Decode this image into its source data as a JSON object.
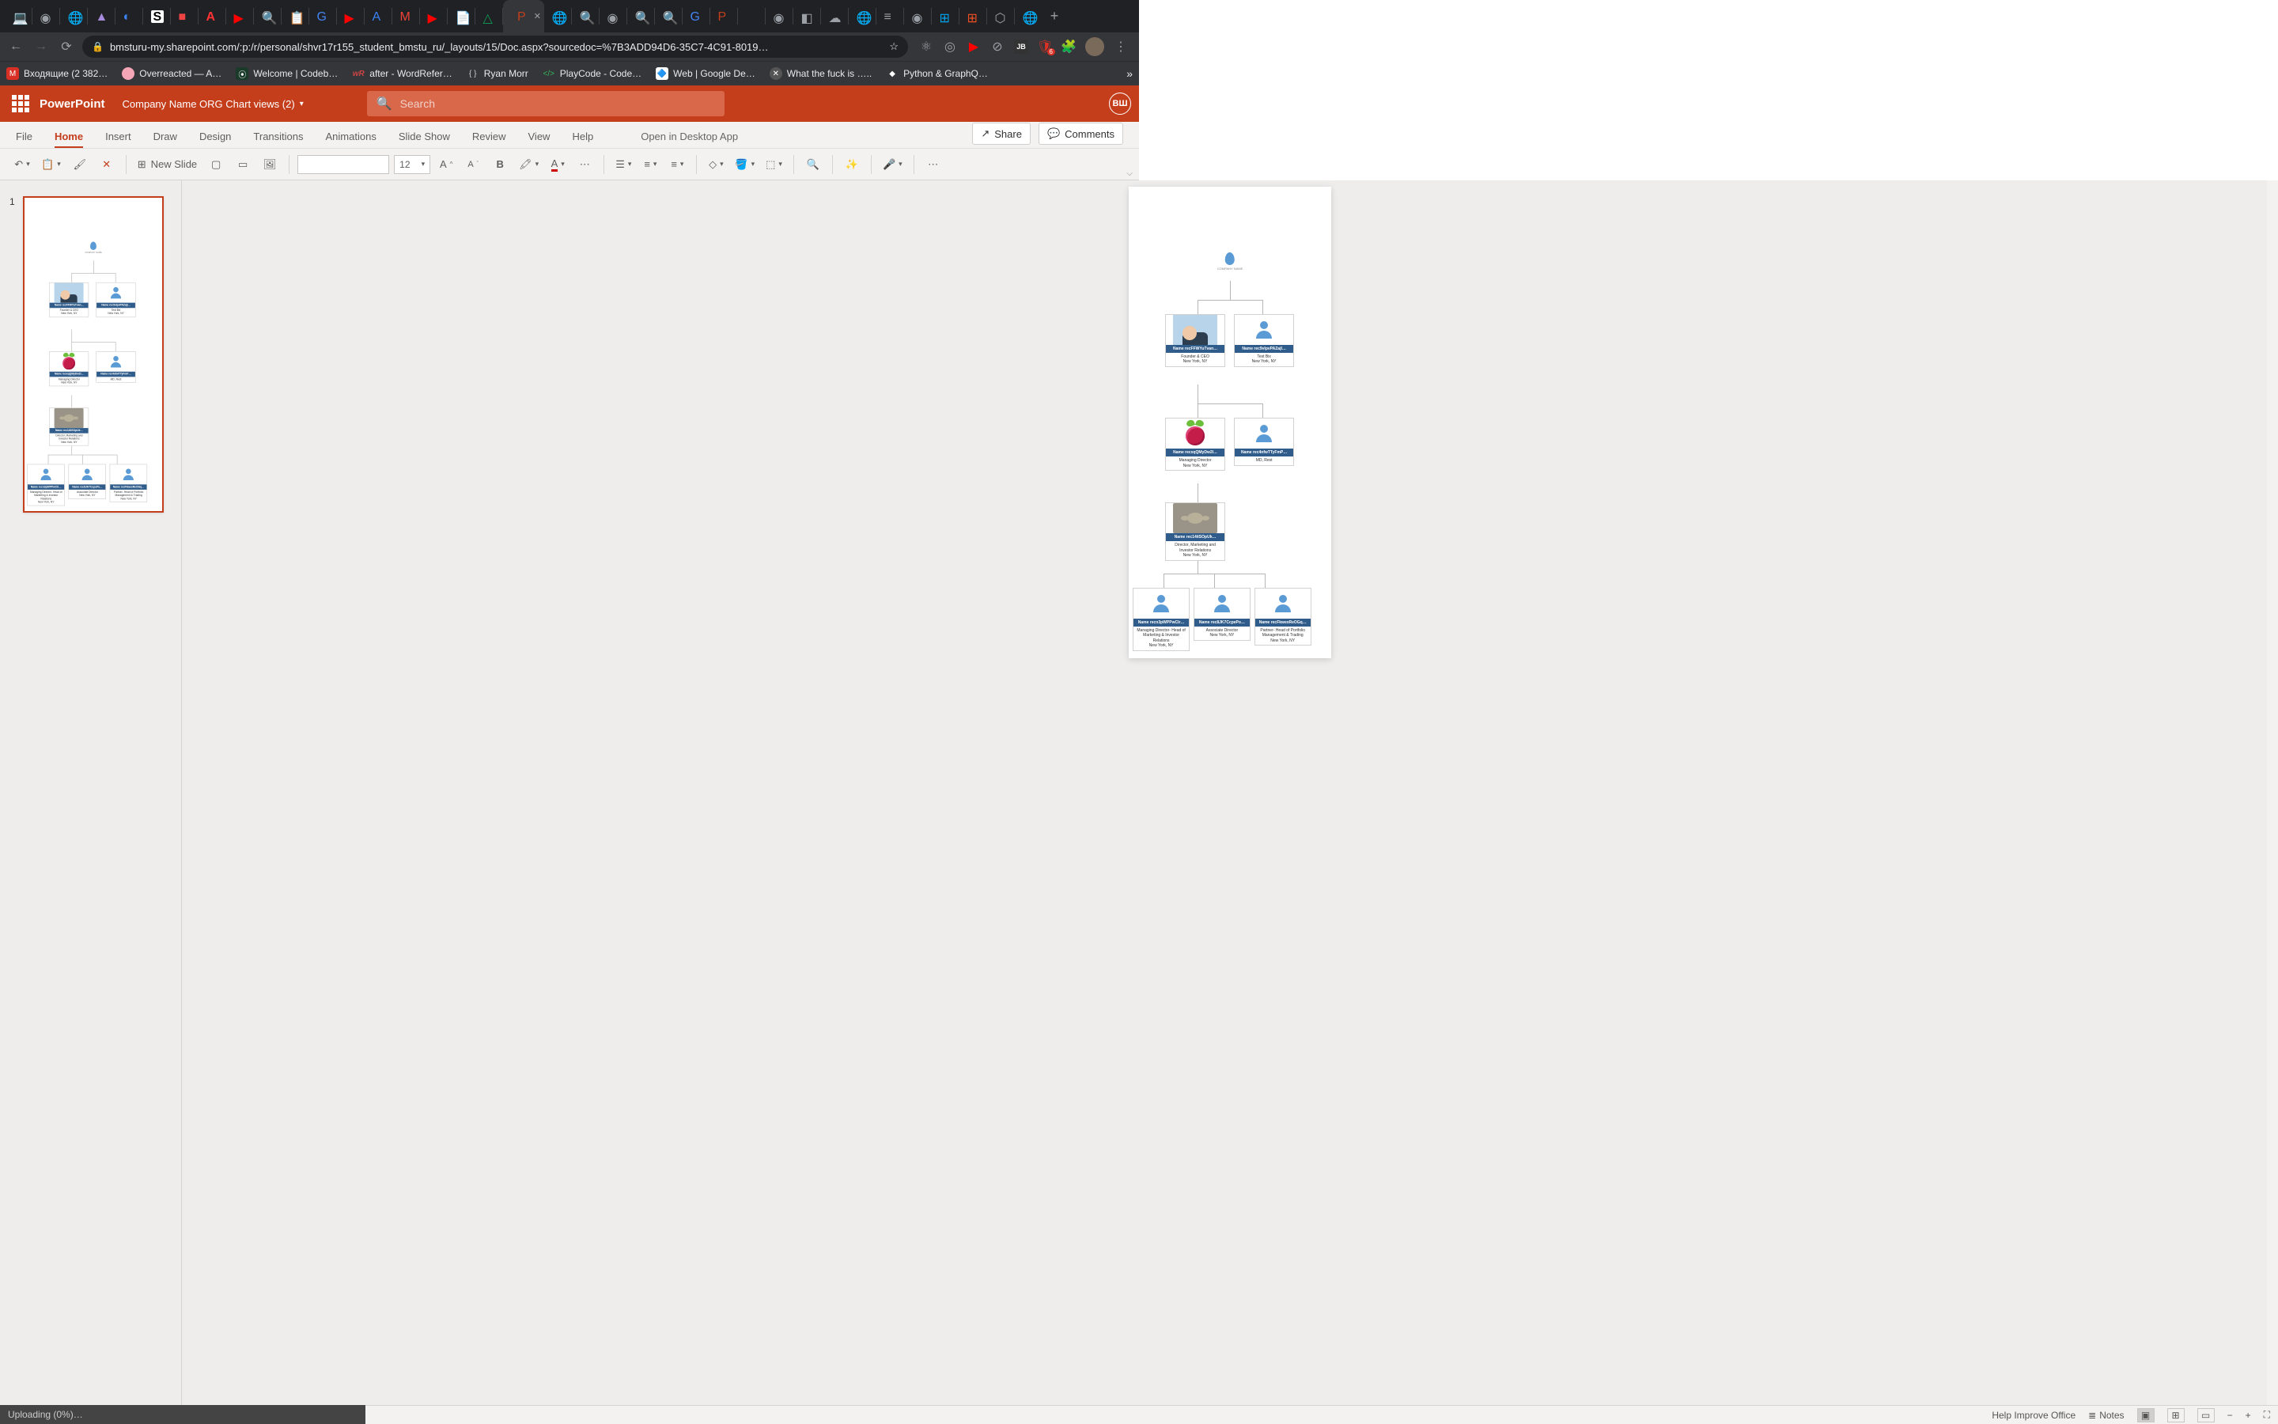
{
  "browser": {
    "url": "bmsturu-my.sharepoint.com/:p:/r/personal/shvr17r155_student_bmstu_ru/_layouts/15/Doc.aspx?sourcedoc=%7B3ADD94D6-35C7-4C91-8019…",
    "badge_count": "6",
    "bookmarks": [
      {
        "label": "Входящие (2 382…",
        "color": "#d93025"
      },
      {
        "label": "Overreacted — A…",
        "color": "#f4a6b7"
      },
      {
        "label": "Welcome | Codeb…",
        "color": "#2a8"
      },
      {
        "label": "after - WordRefer…",
        "color": "#8a3"
      },
      {
        "label": "Ryan Morr",
        "color": "#333"
      },
      {
        "label": "PlayCode - Code…",
        "color": "#35b558"
      },
      {
        "label": "Web  |  Google De…",
        "color": "#4285f4"
      },
      {
        "label": "What the fuck is …..",
        "color": "#555"
      },
      {
        "label": "Python & GraphQ…",
        "color": "#333"
      }
    ]
  },
  "ppt": {
    "app_name": "PowerPoint",
    "doc_title": "Company Name ORG Chart views (2)",
    "search_placeholder": "Search",
    "user_initials": "ВШ",
    "tabs": [
      "File",
      "Home",
      "Insert",
      "Draw",
      "Design",
      "Transitions",
      "Animations",
      "Slide Show",
      "Review",
      "View",
      "Help"
    ],
    "active_tab": "Home",
    "open_desktop": "Open in Desktop App",
    "share": "Share",
    "comments": "Comments",
    "new_slide": "New Slide",
    "font_size": "12"
  },
  "slide": {
    "number": "1",
    "company_logo_text": "COMPANY NAME",
    "nodes": {
      "n1": {
        "name": "Name recFFWYuTvan…",
        "title": "Founder & CEO",
        "loc": "New York, NY"
      },
      "n2": {
        "name": "Name rec9vIpvPAZajI…",
        "title": "Test Bix",
        "loc": "New York, NY"
      },
      "n3": {
        "name": "Name recxqQMyDw2I…",
        "title": "Managing Director",
        "loc": "New York, NY"
      },
      "n4": {
        "name": "Name rec4nfwTTyFmP…",
        "title": "MD, Rest",
        "loc": ""
      },
      "n5": {
        "name": "Name rec14itSOpUk…",
        "title": "Director, Marketing and Investor Relations",
        "loc": "New York, NY"
      },
      "n6": {
        "name": "Name recn3pWPPwCIr…",
        "title": "Managing Director- Head of Marketing & Investor Relations",
        "loc": "New York, NY"
      },
      "n7": {
        "name": "Name rec8JK7CcpePo…",
        "title": "Associate Director",
        "loc": "New York, NY"
      },
      "n8": {
        "name": "Name recFkwexReOGq…",
        "title": "Partner- Head of Portfolio Management & Trading",
        "loc": "New York, NY"
      }
    }
  },
  "status": {
    "uploading": "Uploading (0%)…",
    "help": "Help Improve Office",
    "notes": "Notes"
  }
}
